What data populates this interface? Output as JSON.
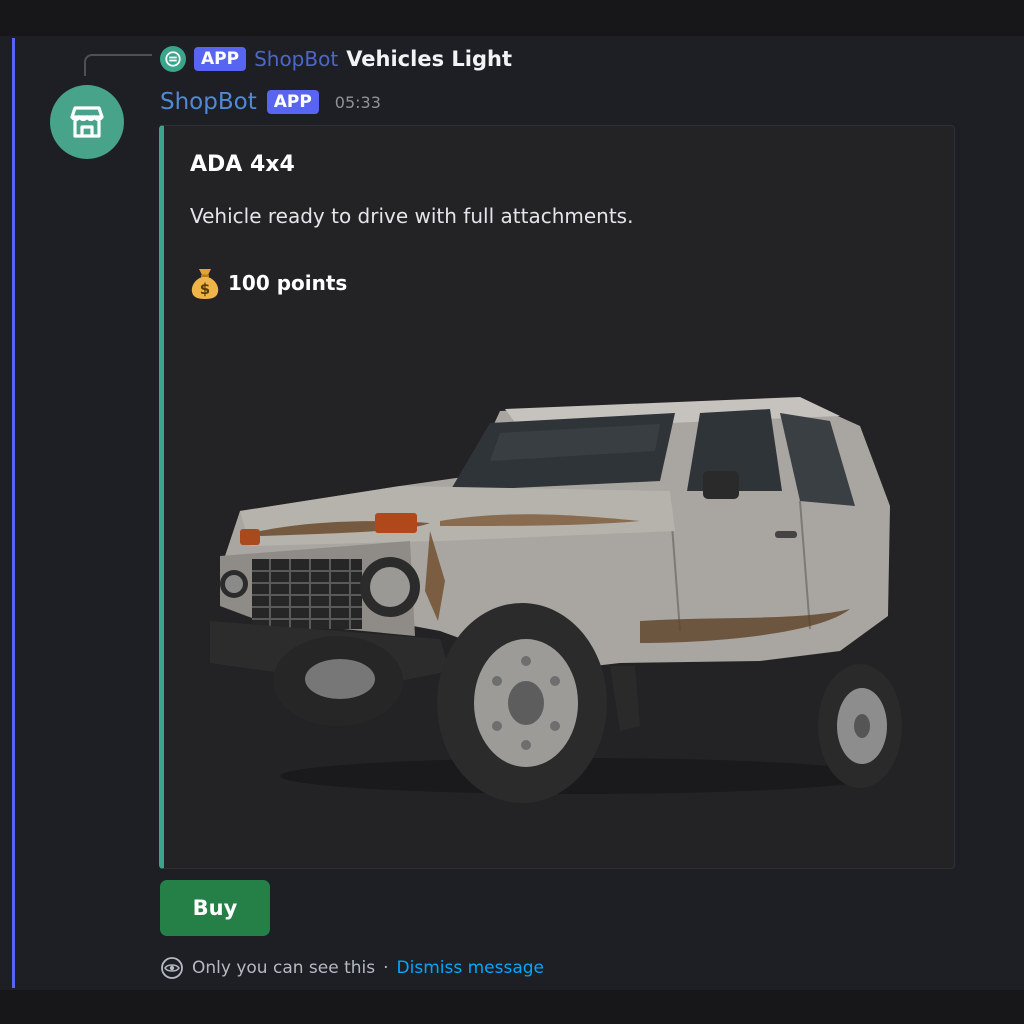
{
  "reply": {
    "badge": "APP",
    "bot_name": "ShopBot",
    "content": "Vehicles Light"
  },
  "message": {
    "author": "ShopBot",
    "badge": "APP",
    "timestamp": "05:33"
  },
  "embed": {
    "title": "ADA 4x4",
    "description": "Vehicle ready to drive with full attachments.",
    "price_icon": "money-bag-icon",
    "price": "100 points",
    "image": "vehicle-image",
    "accent_color": "#3ba58c"
  },
  "actions": {
    "buy_label": "Buy",
    "buy_color": "#248046"
  },
  "ephemeral": {
    "icon": "eye-icon",
    "notice": "Only you can see this",
    "separator": "·",
    "dismiss_label": "Dismiss message"
  },
  "colors": {
    "background": "#1e1f25",
    "accent_line": "#5865f2",
    "app_badge": "#5865f2"
  }
}
